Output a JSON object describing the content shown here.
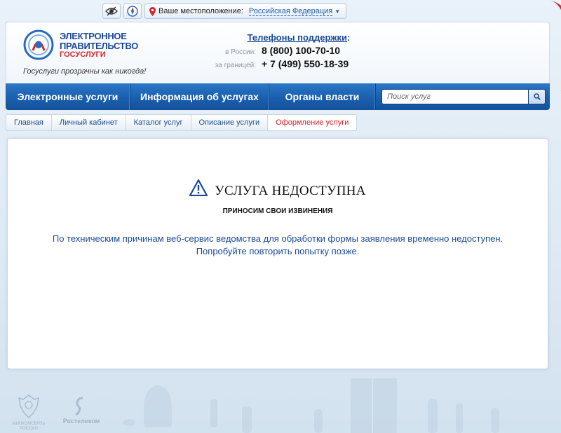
{
  "topbar": {
    "location_label": "Ваше местоположение:",
    "location_value": "Российская Федерация"
  },
  "header": {
    "logo": {
      "line1": "ЭЛЕКТРОННОЕ",
      "line2": "ПРАВИТЕЛЬСТВО",
      "line3": "ГОСУСЛУГИ"
    },
    "slogan": "Госуслуги прозрачны как никогда!",
    "phones": {
      "title": "Телефоны поддержки",
      "title_colon": ":",
      "rows": [
        {
          "label": "в России:",
          "number": "8 (800) 100-70-10"
        },
        {
          "label": "за границей:",
          "number": "+ 7 (499) 550-18-39"
        }
      ]
    }
  },
  "nav": {
    "items": [
      {
        "label": "Электронные услуги"
      },
      {
        "label": "Информация об услугах"
      },
      {
        "label": "Органы власти"
      }
    ],
    "search_placeholder": "Поиск услуг"
  },
  "breadcrumbs": [
    {
      "label": "Главная"
    },
    {
      "label": "Личный кабинет"
    },
    {
      "label": "Каталог услуг"
    },
    {
      "label": "Описание услуги"
    },
    {
      "label": "Оформление услуги"
    }
  ],
  "error": {
    "title": "УСЛУГА НЕДОСТУПНА",
    "subtitle": "ПРИНОСИМ СВОИ ИЗВИНЕНИЯ",
    "message_line1": "По техническим причинам веб-сервис ведомства для обработки формы заявления временно недоступен.",
    "message_line2": "Попробуйте повторить попытку позже."
  },
  "footer": {
    "logo1": "МИНКОМСВЯЗЬ РОССИИ",
    "logo2": "Ростелеком"
  },
  "colors": {
    "brand_blue": "#1a4a96",
    "nav_blue": "#1a5fae",
    "accent_red": "#d6242b"
  },
  "icons": [
    "low-vision-icon",
    "compass-icon",
    "location-pin-icon",
    "caret-down-icon",
    "search-icon",
    "warning-icon",
    "gosuslugi-emblem-icon",
    "coat-of-arms-icon",
    "rostelecom-logo-icon"
  ]
}
